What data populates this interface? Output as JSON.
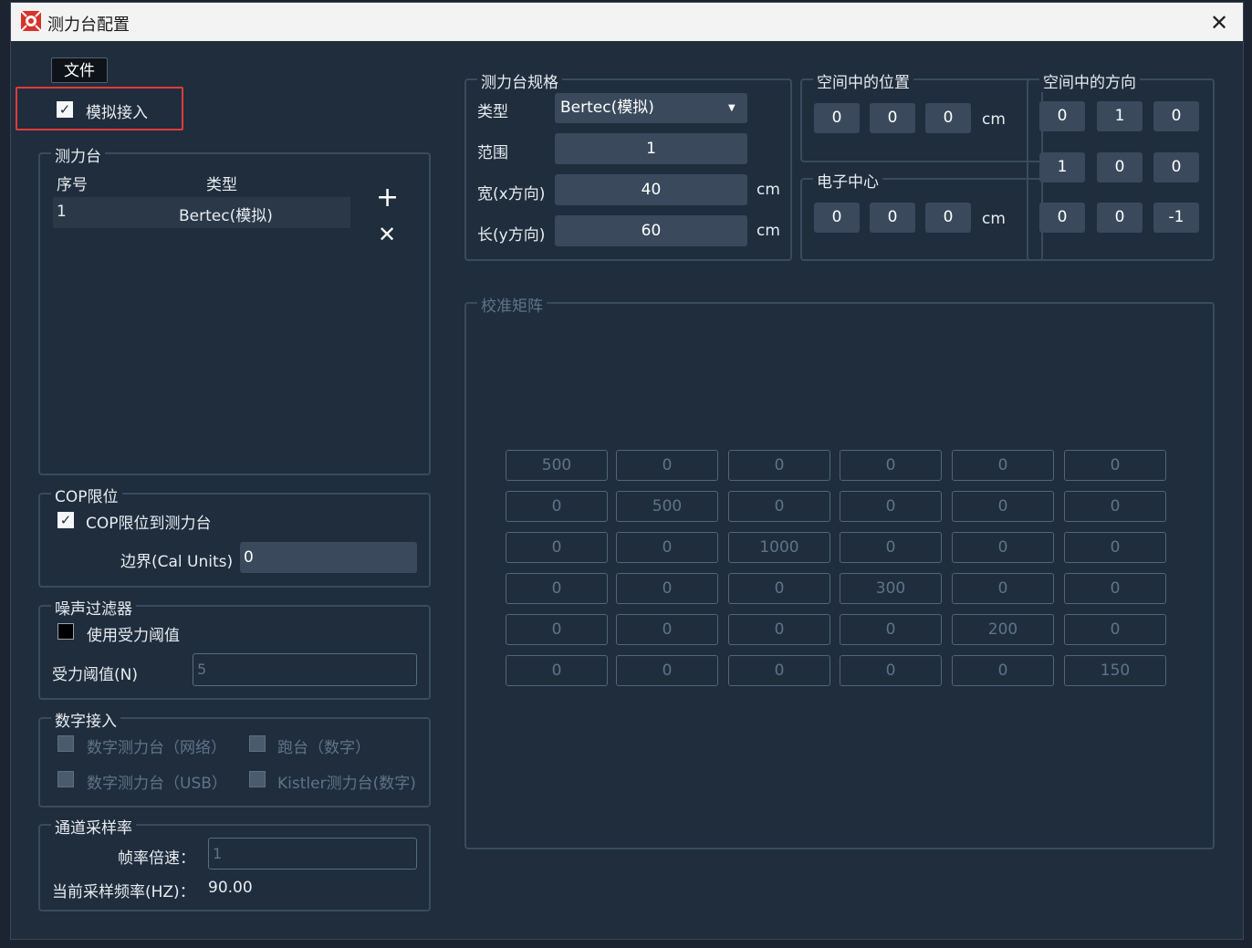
{
  "window": {
    "title": "测力台配置"
  },
  "menu": {
    "file": "文件"
  },
  "simulate": {
    "label": "模拟接入",
    "checked": true
  },
  "forceplate_list": {
    "legend": "测力台",
    "headers": [
      "序号",
      "类型"
    ],
    "rows": [
      {
        "index": "1",
        "type": "Bertec(模拟)"
      }
    ]
  },
  "cop": {
    "legend": "COP限位",
    "checkbox_label": "COP限位到测力台",
    "border_label": "边界(Cal Units)",
    "border_value": "0"
  },
  "noise": {
    "legend": "噪声过滤器",
    "checkbox_label": "使用受力阈值",
    "threshold_label": "受力阈值(N)",
    "threshold_value": "5"
  },
  "digital": {
    "legend": "数字接入",
    "opt1": "数字测力台（网络）",
    "opt2": "跑台（数字）",
    "opt3": "数字测力台（USB）",
    "opt4": "Kistler测力台(数字)"
  },
  "sampling": {
    "legend": "通道采样率",
    "multiplier_label": "帧率倍速：",
    "multiplier_value": "1",
    "freq_label": "当前采样频率(HZ)：",
    "freq_value": "90.00"
  },
  "spec": {
    "legend": "测力台规格",
    "type_label": "类型",
    "type_value": "Bertec(模拟)",
    "range_label": "范围",
    "range_value": "1",
    "width_label": "宽(x方向)",
    "width_value": "40",
    "width_unit": "cm",
    "length_label": "长(y方向)",
    "length_value": "60",
    "length_unit": "cm"
  },
  "position": {
    "legend": "空间中的位置",
    "values": [
      "0",
      "0",
      "0"
    ],
    "unit": "cm"
  },
  "center": {
    "legend": "电子中心",
    "values": [
      "0",
      "0",
      "0"
    ],
    "unit": "cm"
  },
  "orientation": {
    "legend": "空间中的方向",
    "rows": [
      [
        "0",
        "1",
        "0"
      ],
      [
        "1",
        "0",
        "0"
      ],
      [
        "0",
        "0",
        "-1"
      ]
    ]
  },
  "calibration": {
    "legend": "校准矩阵",
    "matrix": [
      [
        "500",
        "0",
        "0",
        "0",
        "0",
        "0"
      ],
      [
        "0",
        "500",
        "0",
        "0",
        "0",
        "0"
      ],
      [
        "0",
        "0",
        "1000",
        "0",
        "0",
        "0"
      ],
      [
        "0",
        "0",
        "0",
        "300",
        "0",
        "0"
      ],
      [
        "0",
        "0",
        "0",
        "0",
        "200",
        "0"
      ],
      [
        "0",
        "0",
        "0",
        "0",
        "0",
        "150"
      ]
    ]
  },
  "colors": {
    "background": "#1f2d3d",
    "field": "#3a4a5c",
    "highlight": "#e03a3a",
    "accent_logo": "#d6332b"
  }
}
